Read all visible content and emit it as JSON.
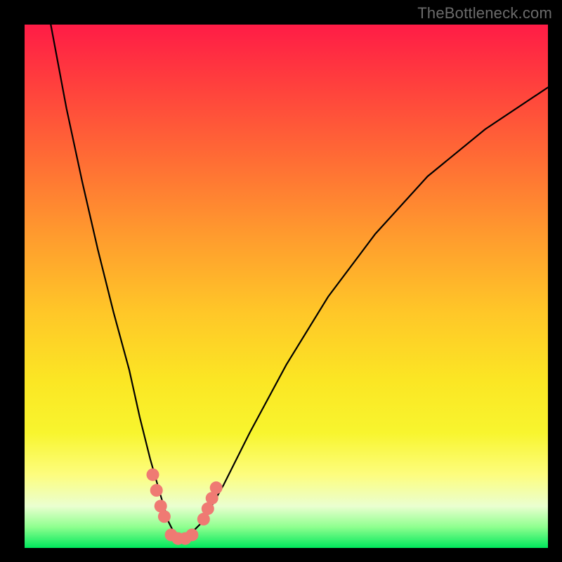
{
  "watermark": "TheBottleneck.com",
  "chart_data": {
    "type": "line",
    "title": "",
    "xlabel": "",
    "ylabel": "",
    "xlim": [
      0,
      100
    ],
    "ylim": [
      0,
      100
    ],
    "grid": false,
    "legend": false,
    "series": [
      {
        "name": "bottleneck-curve",
        "x": [
          5,
          8,
          11,
          14,
          17,
          20,
          22,
          24,
          26,
          27.5,
          29,
          31,
          34,
          38,
          43,
          50,
          58,
          67,
          77,
          88,
          100
        ],
        "values": [
          100,
          84,
          70,
          57,
          45,
          34,
          25,
          17,
          10,
          5,
          2,
          2,
          5,
          12,
          22,
          35,
          48,
          60,
          71,
          80,
          88
        ]
      }
    ],
    "markers": [
      {
        "name": "left-cluster",
        "x": 24.5,
        "values": 14
      },
      {
        "name": "left-cluster",
        "x": 25.2,
        "values": 11
      },
      {
        "name": "left-cluster",
        "x": 26.0,
        "values": 8
      },
      {
        "name": "left-cluster",
        "x": 26.7,
        "values": 6
      },
      {
        "name": "min-cluster",
        "x": 28.0,
        "values": 2.5
      },
      {
        "name": "min-cluster",
        "x": 29.3,
        "values": 1.8
      },
      {
        "name": "min-cluster",
        "x": 30.7,
        "values": 1.8
      },
      {
        "name": "min-cluster",
        "x": 32.0,
        "values": 2.5
      },
      {
        "name": "right-cluster",
        "x": 34.2,
        "values": 5.5
      },
      {
        "name": "right-cluster",
        "x": 35.0,
        "values": 7.5
      },
      {
        "name": "right-cluster",
        "x": 35.8,
        "values": 9.5
      },
      {
        "name": "right-cluster",
        "x": 36.6,
        "values": 11.5
      }
    ]
  },
  "colors": {
    "marker": "#ef7a73",
    "curve": "#000000"
  }
}
